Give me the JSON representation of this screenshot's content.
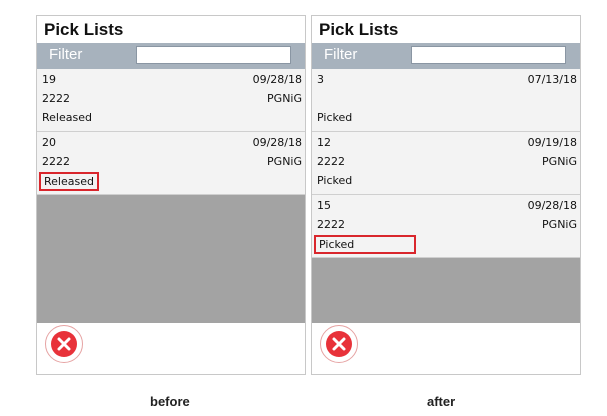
{
  "before": {
    "title": "Pick Lists",
    "filter_label": "Filter",
    "filter_value": "",
    "items": [
      {
        "number": "19",
        "date": "09/28/18",
        "code": "2222",
        "company": "PGNiG",
        "status": "Released"
      },
      {
        "number": "20",
        "date": "09/28/18",
        "code": "2222",
        "company": "PGNiG",
        "status": "Released"
      }
    ]
  },
  "after": {
    "title": "Pick Lists",
    "filter_label": "Filter",
    "filter_value": "",
    "items": [
      {
        "number": "3",
        "date": "07/13/18",
        "code": "",
        "company": "",
        "status": "Picked"
      },
      {
        "number": "12",
        "date": "09/19/18",
        "code": "2222",
        "company": "PGNiG",
        "status": "Picked"
      },
      {
        "number": "15",
        "date": "09/28/18",
        "code": "2222",
        "company": "PGNiG",
        "status": "Picked"
      }
    ]
  },
  "captions": {
    "before": "before",
    "after": "after"
  },
  "colors": {
    "filter_bar": "#a7b2bd",
    "highlight": "#d9262c",
    "close": "#e8323a",
    "list_bg": "#a3a3a3"
  },
  "icons": {
    "close": "close-circle-icon"
  }
}
